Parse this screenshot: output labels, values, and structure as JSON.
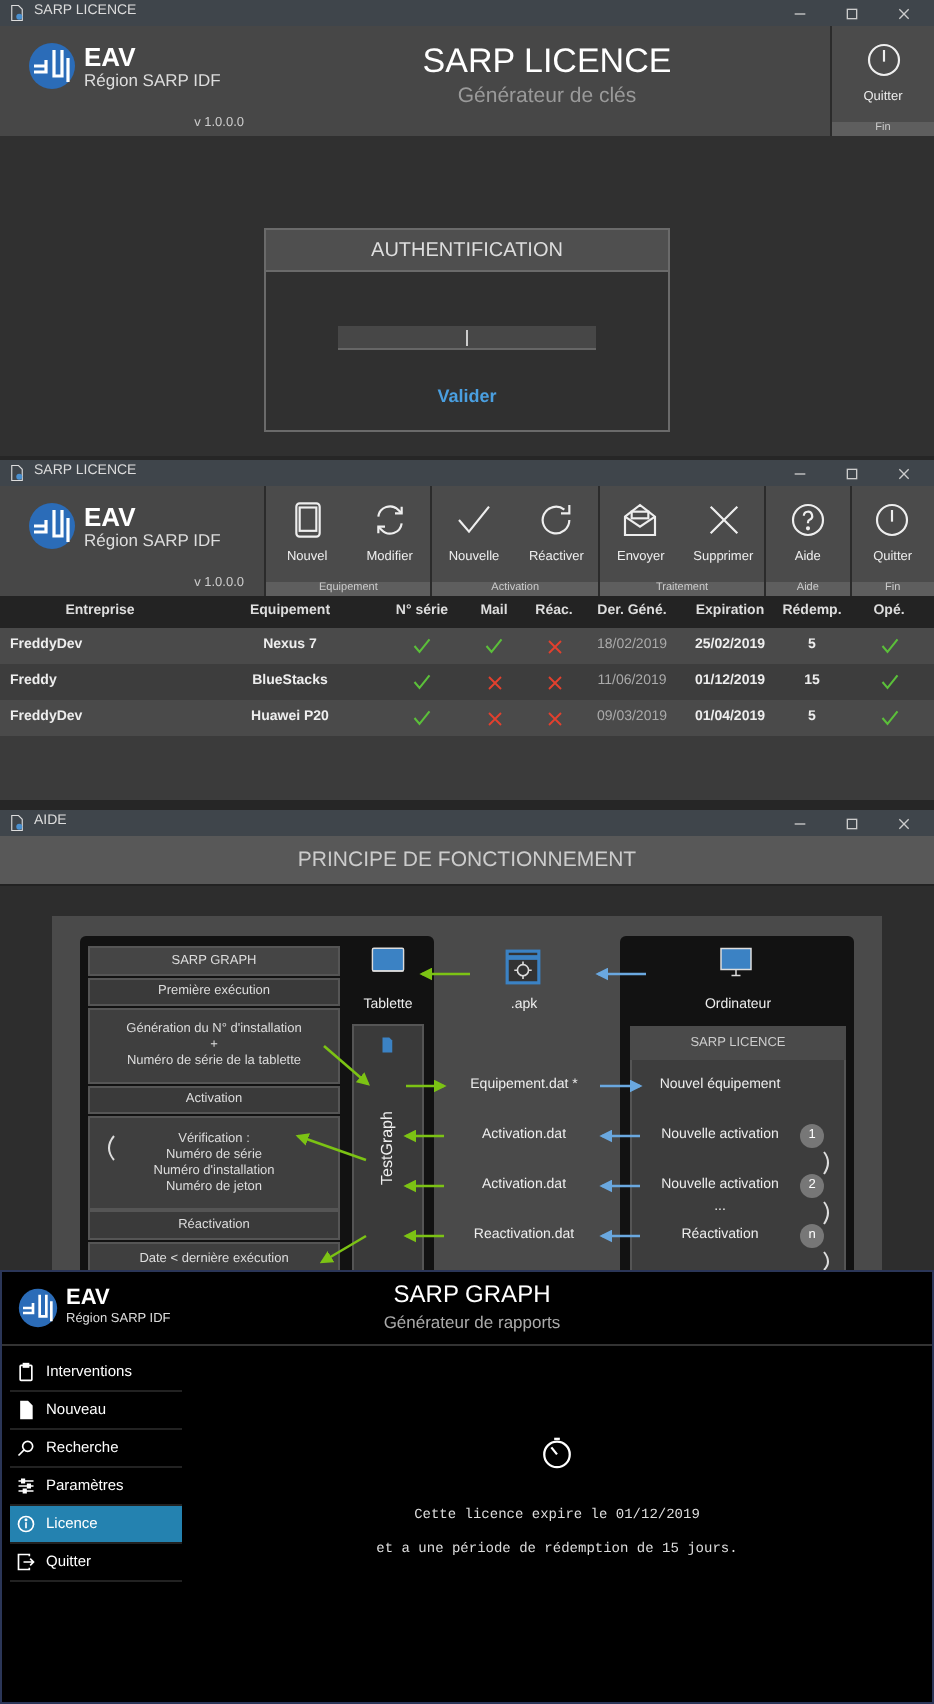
{
  "licence_login": {
    "title": "SARP LICENCE",
    "logo": {
      "brand": "EAV",
      "region": "Région SARP IDF",
      "version": "v 1.0.0.0"
    },
    "app_title": "SARP LICENCE",
    "subtitle": "Générateur de clés",
    "toolbar": [
      {
        "group": "Fin",
        "buttons": [
          "Quitter"
        ]
      }
    ],
    "auth": {
      "title": "AUTHENTIFICATION",
      "field": {
        "focused": true
      },
      "submit": "Valider"
    }
  },
  "licence_main": {
    "title": "SARP LICENCE",
    "logo": {
      "brand": "EAV",
      "region": "Région SARP IDF",
      "version": "v 1.0.0.0"
    },
    "toolbar": [
      {
        "group": "Equipement",
        "buttons": [
          "Nouvel",
          "Modifier"
        ]
      },
      {
        "group": "Activation",
        "buttons": [
          "Nouvelle",
          "Réactiver"
        ]
      },
      {
        "group": "Traitement",
        "buttons": [
          "Envoyer",
          "Supprimer"
        ]
      },
      {
        "group": "Aide",
        "buttons": [
          "Aide"
        ]
      },
      {
        "group": "Fin",
        "buttons": [
          "Quitter"
        ]
      }
    ],
    "table": {
      "columns": [
        "Entreprise",
        "Equipement",
        "N° série",
        "Mail",
        "Réac.",
        "Der. Géné.",
        "Expiration",
        "Rédemp.",
        "Opé."
      ],
      "rows": [
        {
          "company": "FreddyDev",
          "device": "Nexus 7",
          "serial": true,
          "mail": true,
          "reactivation": false,
          "last_generated": "18/02/2019",
          "expiration": "25/02/2019",
          "redemption": "5",
          "operational": true
        },
        {
          "company": "Freddy",
          "device": "BlueStacks",
          "serial": true,
          "mail": false,
          "reactivation": false,
          "last_generated": "11/06/2019",
          "expiration": "01/12/2019",
          "redemption": "15",
          "operational": true
        },
        {
          "company": "FreddyDev",
          "device": "Huawei P20",
          "serial": true,
          "mail": false,
          "reactivation": false,
          "last_generated": "09/03/2019",
          "expiration": "01/04/2019",
          "redemption": "5",
          "operational": true
        }
      ]
    }
  },
  "help": {
    "title": "AIDE",
    "heading": "PRINCIPE DE FONCTIONNEMENT",
    "sarp_graph": {
      "title": "SARP GRAPH",
      "sections": [
        {
          "heading": "Première exécution",
          "lines": [
            "Génération du N° d'installation",
            "+",
            "Numéro de série de la tablette"
          ]
        },
        {
          "heading": "Activation",
          "lines": [
            "Vérification :",
            "Numéro de série",
            "Numéro d'installation",
            "Numéro de jeton"
          ]
        },
        {
          "heading": "Réactivation",
          "lines": [
            "Date < dernière exécution"
          ]
        }
      ]
    },
    "tablet_label": "Tablette",
    "apk_label": ".apk",
    "computer_label": "Ordinateur",
    "app_label": "TestGraph",
    "files": [
      "Equipement.dat *",
      "Activation.dat",
      "Activation.dat",
      "Reactivation.dat"
    ],
    "licence_panel": {
      "title": "SARP LICENCE",
      "actions": [
        {
          "label": "Nouvel équipement"
        },
        {
          "label": "Nouvelle activation",
          "step": "1"
        },
        {
          "label": "Nouvelle activation",
          "step": "2"
        },
        {
          "label": "Réactivation",
          "step": "n"
        }
      ],
      "gap_text": "..."
    }
  },
  "graph_app": {
    "logo": {
      "brand": "EAV",
      "region": "Région SARP IDF"
    },
    "title": "SARP GRAPH",
    "subtitle": "Générateur de rapports",
    "menu": [
      {
        "label": "Interventions",
        "selected": false
      },
      {
        "label": "Nouveau",
        "selected": false
      },
      {
        "label": "Recherche",
        "selected": false
      },
      {
        "label": "Paramètres",
        "selected": false
      },
      {
        "label": "Licence",
        "selected": true
      },
      {
        "label": "Quitter",
        "selected": false
      }
    ],
    "licence_info": [
      "Cette licence expire le 01/12/2019",
      "et a une période de rédemption de 15 jours."
    ]
  }
}
